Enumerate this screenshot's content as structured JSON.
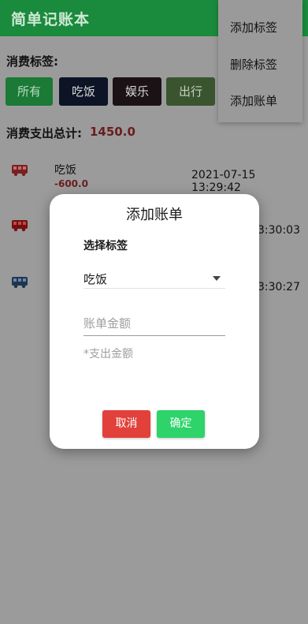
{
  "app": {
    "title": "简单记账本"
  },
  "tags": {
    "label": "消费标签:",
    "buttons": [
      "所有",
      "吃饭",
      "娱乐",
      "出行"
    ]
  },
  "total": {
    "label": "消费支出总计:",
    "value": "1450.0"
  },
  "records": [
    {
      "name": "吃饭",
      "amount": "-600.0",
      "time": "2021-07-15 13:29:42",
      "icon": "bus-icon",
      "icon_color": "#7a2020"
    },
    {
      "name": "",
      "amount": "",
      "time": "3:30:03",
      "icon": "bus-icon",
      "icon_color": "#7a0e0e"
    },
    {
      "name": "",
      "amount": "",
      "time": "3:30:27",
      "icon": "bus-icon",
      "icon_color": "#1d3550"
    }
  ],
  "menu": {
    "items": [
      "添加标签",
      "删除标签",
      "添加账单"
    ]
  },
  "dialog": {
    "title": "添加账单",
    "select_label": "选择标签",
    "selected_tag": "吃饭",
    "amount_placeholder": "账单金额",
    "hint": "*支出金额",
    "cancel": "取消",
    "confirm": "确定"
  },
  "colors": {
    "primary": "#1a8a3c",
    "cancel": "#e2413b",
    "confirm": "#2ed36a",
    "amount_red": "#6a1d1d"
  }
}
